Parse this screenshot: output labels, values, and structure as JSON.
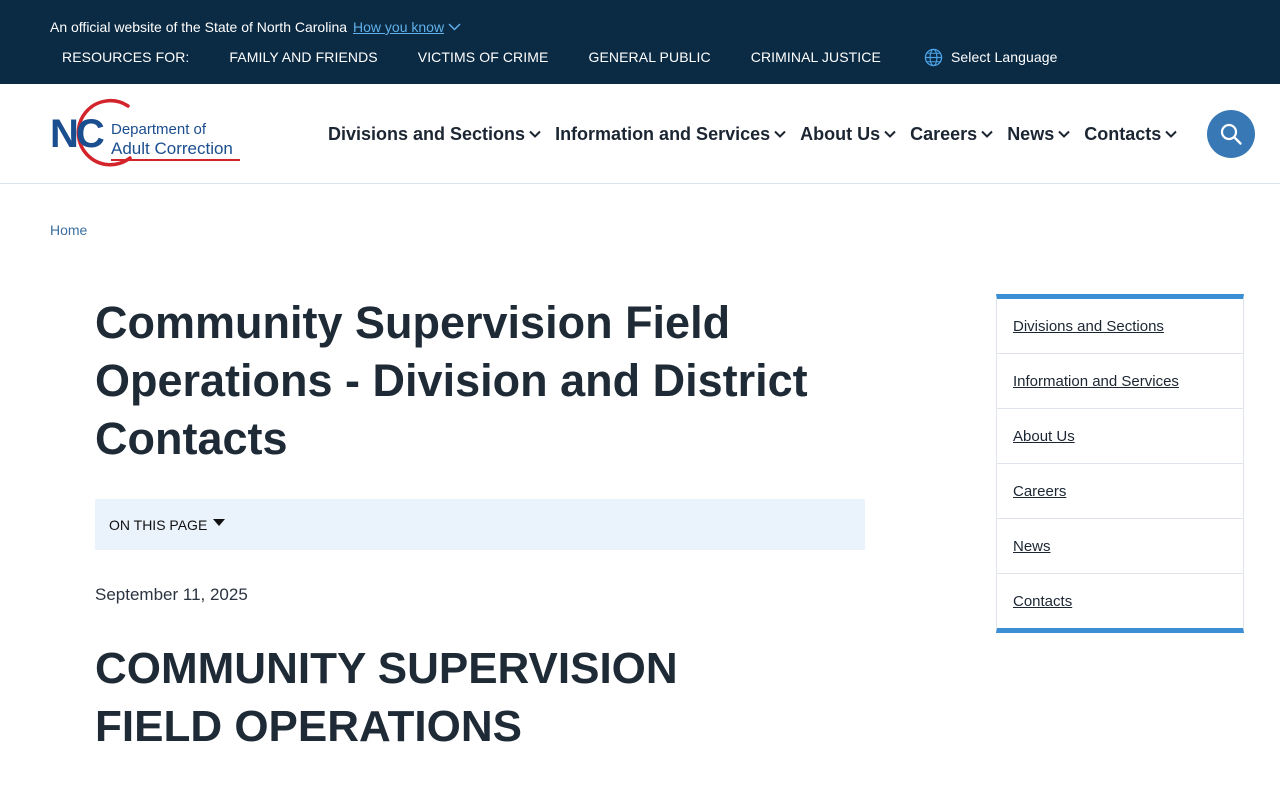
{
  "banner": {
    "official_text": "An official website of the State of North Carolina",
    "how_you_know": "How you know",
    "resources_label": "RESOURCES FOR:",
    "resources": [
      "FAMILY AND FRIENDS",
      "VICTIMS OF CRIME",
      "GENERAL PUBLIC",
      "CRIMINAL JUSTICE"
    ],
    "language": "Select Language"
  },
  "logo": {
    "nc": "NC",
    "line1": "Department of",
    "line2": "Adult Correction"
  },
  "nav": {
    "items": [
      "Divisions and Sections",
      "Information and Services",
      "About Us",
      "Careers",
      "News",
      "Contacts"
    ]
  },
  "breadcrumb": {
    "home": "Home"
  },
  "main": {
    "title": "Community Supervision Field Operations - Division and District Contacts",
    "on_this_page": "ON THIS PAGE",
    "date": "September 11, 2025",
    "heading": "COMMUNITY SUPERVISION FIELD OPERATIONS"
  },
  "sidebar": {
    "items": [
      "Divisions and Sections",
      "Information and Services",
      "About Us",
      "Careers",
      "News",
      "Contacts"
    ]
  },
  "colors": {
    "banner_bg": "#0b2a43",
    "link_blue": "#5fb0ea",
    "brand_blue": "#1b4e8f",
    "brand_red": "#d3242c",
    "search_bg": "#3878b5",
    "sidebar_accent": "#3c8fd4",
    "on_this_page_bg": "#eaf3fc"
  },
  "icons": {
    "how_you_know": "chevron-down-icon",
    "language": "globe-icon",
    "nav_dropdown": "chevron-down-icon",
    "search": "search-icon",
    "on_this_page": "caret-down-icon"
  }
}
